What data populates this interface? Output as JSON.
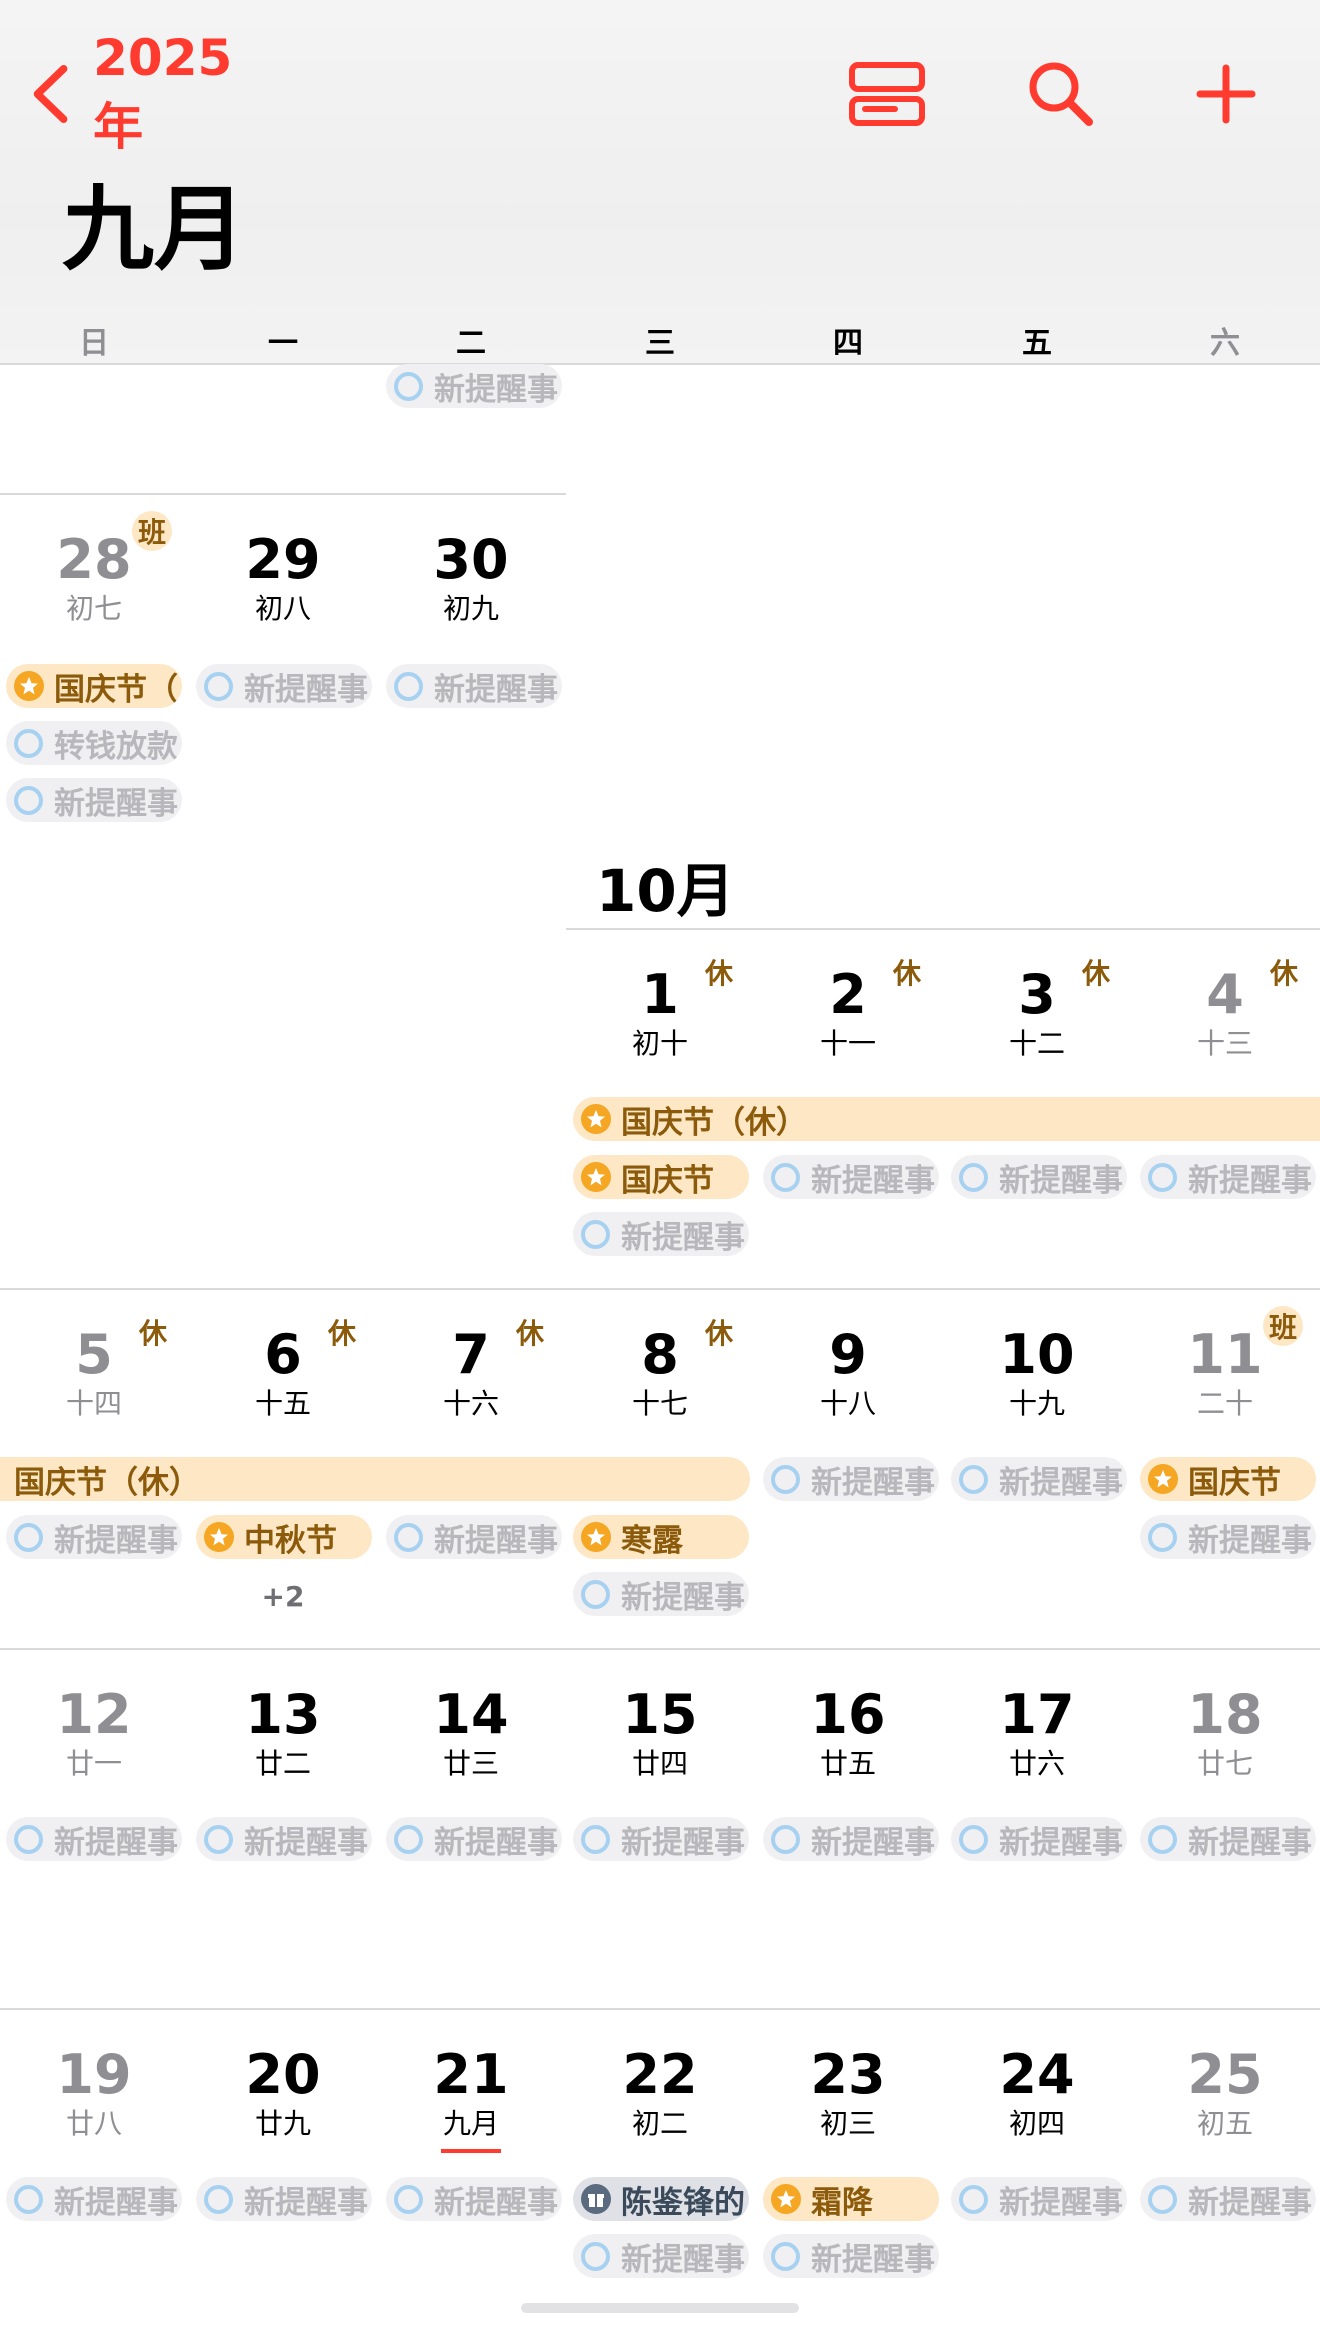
{
  "nav": {
    "back_label": "2025年"
  },
  "header": {
    "month_title": "九月",
    "weekdays": [
      "日",
      "一",
      "二",
      "三",
      "四",
      "五",
      "六"
    ]
  },
  "october_title": "10月",
  "colors": {
    "accent": "#ff3b30",
    "holiday_bg": "#fde7c4",
    "reminder_ring": "#a7d1f0"
  },
  "days": [
    {
      "num": "28",
      "lunar": "初七",
      "badge": "班",
      "weekend": true
    },
    {
      "num": "29",
      "lunar": "初八"
    },
    {
      "num": "30",
      "lunar": "初九"
    },
    {
      "num": "1",
      "lunar": "初十",
      "badge": "休"
    },
    {
      "num": "2",
      "lunar": "十一",
      "badge": "休"
    },
    {
      "num": "3",
      "lunar": "十二",
      "badge": "休"
    },
    {
      "num": "4",
      "lunar": "十三",
      "badge": "休",
      "weekend": true
    },
    {
      "num": "5",
      "lunar": "十四",
      "badge": "休",
      "weekend": true
    },
    {
      "num": "6",
      "lunar": "十五",
      "badge": "休"
    },
    {
      "num": "7",
      "lunar": "十六",
      "badge": "休"
    },
    {
      "num": "8",
      "lunar": "十七",
      "badge": "休"
    },
    {
      "num": "9",
      "lunar": "十八"
    },
    {
      "num": "10",
      "lunar": "十九"
    },
    {
      "num": "11",
      "lunar": "二十",
      "badge": "班",
      "weekend": true
    },
    {
      "num": "12",
      "lunar": "廿一",
      "weekend": true
    },
    {
      "num": "13",
      "lunar": "廿二"
    },
    {
      "num": "14",
      "lunar": "廿三"
    },
    {
      "num": "15",
      "lunar": "廿四"
    },
    {
      "num": "16",
      "lunar": "廿五"
    },
    {
      "num": "17",
      "lunar": "廿六"
    },
    {
      "num": "18",
      "lunar": "廿七",
      "weekend": true
    },
    {
      "num": "19",
      "lunar": "廿八",
      "weekend": true
    },
    {
      "num": "20",
      "lunar": "廿九"
    },
    {
      "num": "21",
      "lunar": "九月",
      "today": true
    },
    {
      "num": "22",
      "lunar": "初二"
    },
    {
      "num": "23",
      "lunar": "初三"
    },
    {
      "num": "24",
      "lunar": "初四"
    },
    {
      "num": "25",
      "lunar": "初五",
      "weekend": true
    }
  ],
  "events": [
    {
      "type": "rem",
      "text": "新提醒事"
    },
    {
      "type": "hol",
      "text": "国庆节（"
    },
    {
      "type": "rem",
      "text": "新提醒事"
    },
    {
      "type": "rem",
      "text": "新提醒事"
    },
    {
      "type": "rem",
      "text": "转钱放款"
    },
    {
      "type": "rem",
      "text": "新提醒事"
    },
    {
      "type": "hol",
      "text": "国庆节（休）"
    },
    {
      "type": "hol",
      "text": "国庆节"
    },
    {
      "type": "rem",
      "text": "新提醒事"
    },
    {
      "type": "rem",
      "text": "新提醒事"
    },
    {
      "type": "rem",
      "text": "新提醒事"
    },
    {
      "type": "rem",
      "text": "新提醒事"
    },
    {
      "type": "holplain",
      "text": "国庆节（休）"
    },
    {
      "type": "rem",
      "text": "新提醒事"
    },
    {
      "type": "rem",
      "text": "新提醒事"
    },
    {
      "type": "hol",
      "text": "国庆节"
    },
    {
      "type": "rem",
      "text": "新提醒事"
    },
    {
      "type": "hol",
      "text": "中秋节"
    },
    {
      "type": "rem",
      "text": "新提醒事"
    },
    {
      "type": "hol",
      "text": "寒露"
    },
    {
      "type": "rem",
      "text": "新提醒事"
    },
    {
      "type": "rem",
      "text": "新提醒事"
    },
    {
      "type": "rem",
      "text": "新提醒事"
    },
    {
      "type": "rem",
      "text": "新提醒事"
    },
    {
      "type": "rem",
      "text": "新提醒事"
    },
    {
      "type": "rem",
      "text": "新提醒事"
    },
    {
      "type": "rem",
      "text": "新提醒事"
    },
    {
      "type": "rem",
      "text": "新提醒事"
    },
    {
      "type": "rem",
      "text": "新提醒事"
    },
    {
      "type": "rem",
      "text": "新提醒事"
    },
    {
      "type": "rem",
      "text": "新提醒事"
    },
    {
      "type": "rem",
      "text": "新提醒事"
    },
    {
      "type": "bday",
      "text": "陈鉴锋的"
    },
    {
      "type": "hol",
      "text": "霜降"
    },
    {
      "type": "rem",
      "text": "新提醒事"
    },
    {
      "type": "rem",
      "text": "新提醒事"
    },
    {
      "type": "rem",
      "text": "新提醒事"
    },
    {
      "type": "rem",
      "text": "新提醒事"
    }
  ],
  "more": [
    "+2"
  ]
}
